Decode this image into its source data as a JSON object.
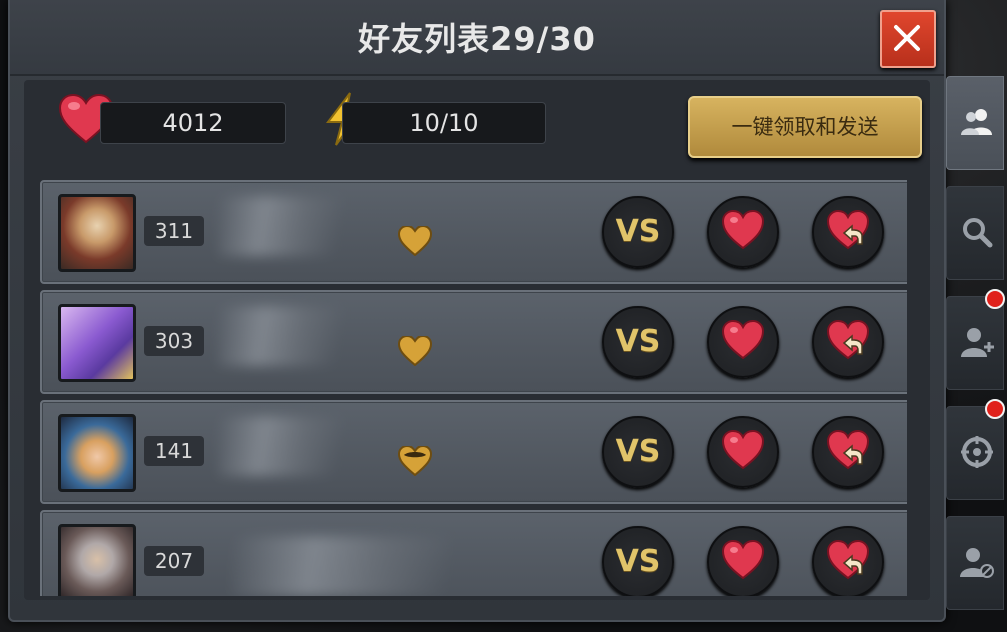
{
  "title": "好友列表29/30",
  "close_icon": "close-icon",
  "stats": {
    "hearts": "4012",
    "energy": "10/10"
  },
  "collect_button": "一键领取和发送",
  "actions": {
    "vs_label": "VS"
  },
  "friends": [
    {
      "level": "311",
      "avatar_icon": "avatar-warrior-icon"
    },
    {
      "level": "303",
      "avatar_icon": "avatar-anniversary-icon"
    },
    {
      "level": "141",
      "avatar_icon": "avatar-heroine-icon"
    },
    {
      "level": "207",
      "avatar_icon": "avatar-silver-hair-icon"
    }
  ],
  "side_tabs": [
    {
      "icon": "friends-icon",
      "active": true,
      "badge": false
    },
    {
      "icon": "search-icon",
      "active": false,
      "badge": false
    },
    {
      "icon": "add-friend-icon",
      "active": false,
      "badge": true
    },
    {
      "icon": "target-icon",
      "active": false,
      "badge": true
    },
    {
      "icon": "blocked-user-icon",
      "active": false,
      "badge": false
    }
  ],
  "colors": {
    "close_red": "#d33a22",
    "gold_button": "#c9a34f",
    "heart_red": "#e0384f",
    "badge_red": "#e0211b"
  }
}
